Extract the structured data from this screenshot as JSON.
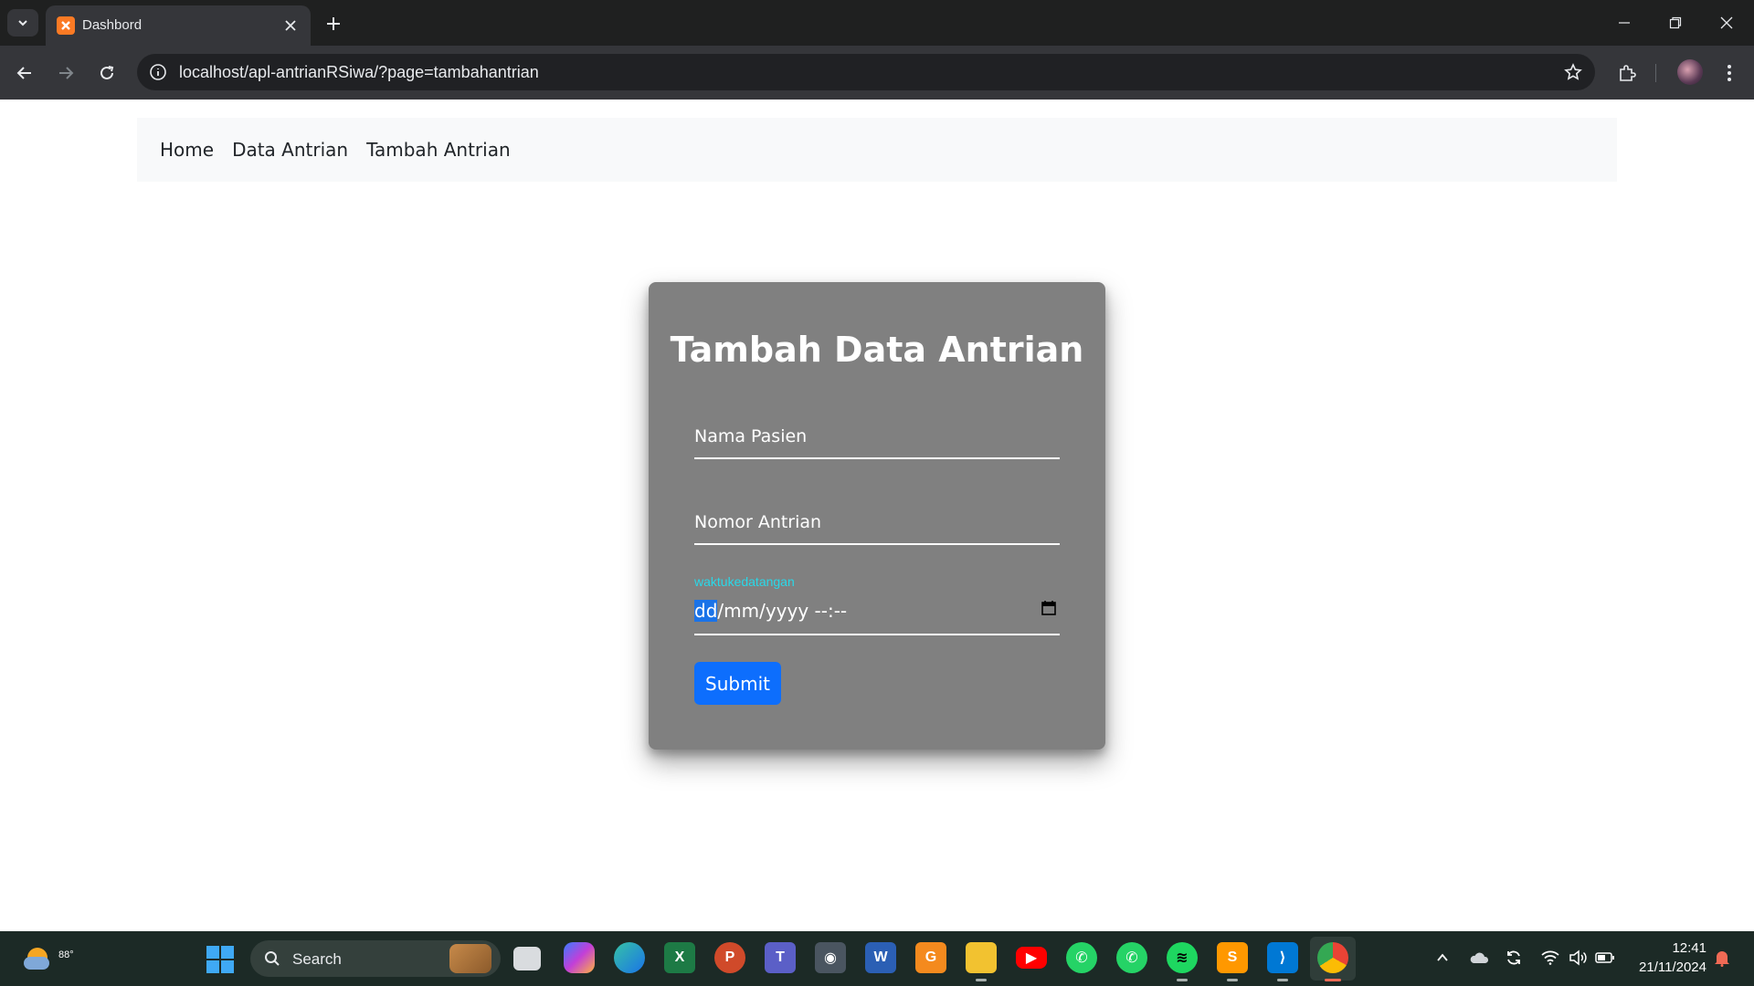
{
  "browser": {
    "tab_title": "Dashbord",
    "url": "localhost/apl-antrianRSiwa/?page=tambahantrian"
  },
  "nav": {
    "links": [
      "Home",
      "Data Antrian",
      "Tambah Antrian"
    ]
  },
  "form": {
    "title": "Tambah Data Antrian",
    "nama_placeholder": "Nama Pasien",
    "nomor_placeholder": "Nomor Antrian",
    "datetime_label": "waktukedatangan",
    "datetime_highlight": "dd",
    "datetime_rest": "/mm/yyyy --:--",
    "submit_label": "Submit"
  },
  "taskbar": {
    "weather_temp": "88°",
    "search_label": "Search",
    "clock_time": "12:41",
    "clock_date": "21/11/2024",
    "apps": [
      "task-view",
      "copilot",
      "edge",
      "excel",
      "powerpoint",
      "teams",
      "camera",
      "word",
      "pdf-app",
      "file-explorer",
      "youtube",
      "whatsapp",
      "whatsapp-2",
      "spotify",
      "sublime-text",
      "vscode",
      "chrome"
    ]
  },
  "colors": {
    "card_bg": "#808080",
    "submit_bg": "#0d6efd",
    "label_color": "#29d8e8",
    "navbar_bg": "#f8f9fa"
  }
}
